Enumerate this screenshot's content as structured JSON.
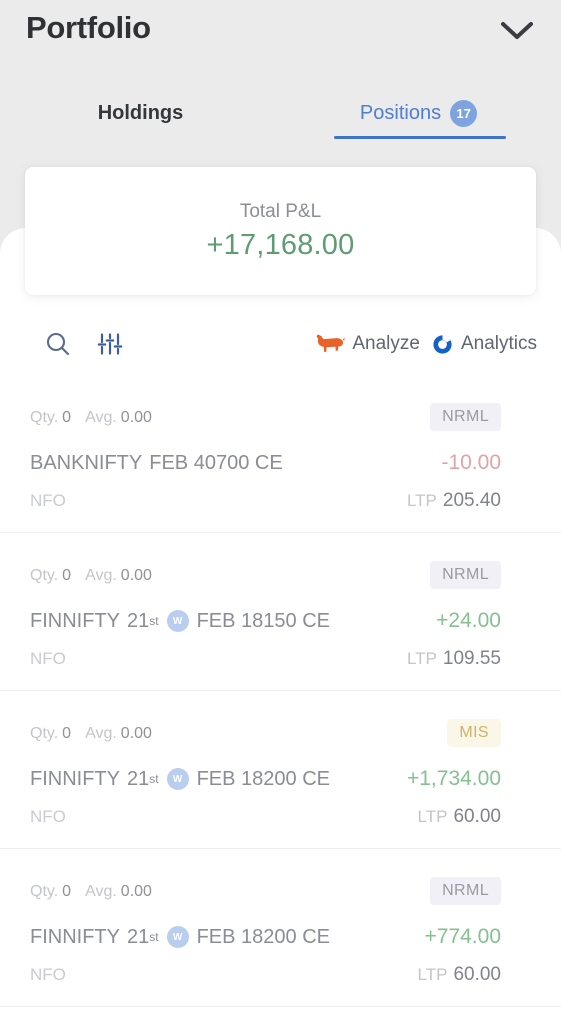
{
  "header": {
    "title": "Portfolio",
    "collapse_icon": "chevron-down-icon"
  },
  "tabs": [
    {
      "label": "Holdings",
      "badge": null,
      "active": false
    },
    {
      "label": "Positions",
      "badge": "17",
      "active": true
    }
  ],
  "pnl_card": {
    "label": "Total P&L",
    "value": "+17,168.00",
    "value_color": "#5e9c72"
  },
  "toolbar": {
    "search_icon": "search-icon",
    "filter_icon": "filter-sliders-icon",
    "actions": [
      {
        "label": "Analyze",
        "icon": "bull-icon",
        "icon_color": "#e8622a"
      },
      {
        "label": "Analytics",
        "icon": "donut-ring-icon",
        "icon_color": "#1463c4"
      }
    ]
  },
  "positions": [
    {
      "qty_label": "Qty.",
      "qty_value": "0",
      "avg_label": "Avg.",
      "avg_value": "0.00",
      "product": "NRML",
      "instrument_prefix": "BANKNIFTY",
      "expiry_day": "",
      "expiry_suffix": "",
      "weekly_badge": "",
      "instrument_suffix": "FEB 40700 CE",
      "pnl": "-10.00",
      "pnl_sign": "neg",
      "exchange": "NFO",
      "ltp_label": "LTP",
      "ltp_value": "205.40"
    },
    {
      "qty_label": "Qty.",
      "qty_value": "0",
      "avg_label": "Avg.",
      "avg_value": "0.00",
      "product": "NRML",
      "instrument_prefix": "FINNIFTY",
      "expiry_day": "21",
      "expiry_suffix": "st",
      "weekly_badge": "W",
      "instrument_suffix": "FEB 18150 CE",
      "pnl": "+24.00",
      "pnl_sign": "pos",
      "exchange": "NFO",
      "ltp_label": "LTP",
      "ltp_value": "109.55"
    },
    {
      "qty_label": "Qty.",
      "qty_value": "0",
      "avg_label": "Avg.",
      "avg_value": "0.00",
      "product": "MIS",
      "instrument_prefix": "FINNIFTY",
      "expiry_day": "21",
      "expiry_suffix": "st",
      "weekly_badge": "W",
      "instrument_suffix": "FEB 18200 CE",
      "pnl": "+1,734.00",
      "pnl_sign": "pos",
      "exchange": "NFO",
      "ltp_label": "LTP",
      "ltp_value": "60.00"
    },
    {
      "qty_label": "Qty.",
      "qty_value": "0",
      "avg_label": "Avg.",
      "avg_value": "0.00",
      "product": "NRML",
      "instrument_prefix": "FINNIFTY",
      "expiry_day": "21",
      "expiry_suffix": "st",
      "weekly_badge": "W",
      "instrument_suffix": "FEB 18200 CE",
      "pnl": "+774.00",
      "pnl_sign": "pos",
      "exchange": "NFO",
      "ltp_label": "LTP",
      "ltp_value": "60.00"
    }
  ]
}
